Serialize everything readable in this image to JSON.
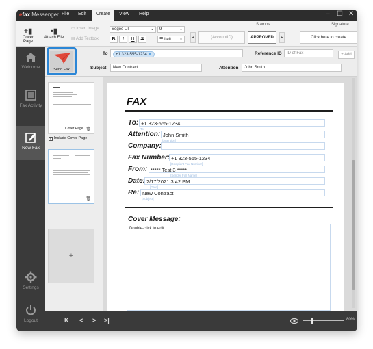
{
  "app": {
    "brand_e": "e",
    "brand": "fax",
    "product": "Messenger"
  },
  "menu": {
    "items": [
      "File",
      "Edit",
      "Create",
      "View",
      "Help"
    ],
    "active": "Create"
  },
  "window_controls": {
    "minimize": "–",
    "maximize": "☐",
    "close": "✕"
  },
  "ribbon": {
    "cover_page": "Cover Page",
    "attach_file": "Attach File",
    "insert_image": "Insert Image",
    "add_textbox": "Add Textbox",
    "font": "Segoe UI",
    "size": "9",
    "align": "Left",
    "bold": "B",
    "italic": "I",
    "underline": "U",
    "strike": "S",
    "stamps_label": "Stamps",
    "stamp_account": "(AccountID)",
    "stamp_approved": "APPROVED",
    "signature_label": "Signature",
    "signature_button": "Click here to create"
  },
  "sidebar": {
    "items": [
      {
        "label": "Welcome"
      },
      {
        "label": "Fax Activity"
      },
      {
        "label": "New Fax"
      },
      {
        "label": "Settings"
      },
      {
        "label": "Logout"
      }
    ],
    "active": "New Fax"
  },
  "header": {
    "send_fax": "Send Fax",
    "to_label": "To",
    "to_chip": "+1 323-555-1234",
    "reference_label": "Reference ID",
    "reference_placeholder": "ID of Fax",
    "add_label": "+ Add",
    "subject_label": "Subject",
    "subject_value": "New Contract",
    "attention_label": "Attention",
    "attention_value": "John Smith"
  },
  "thumbnails": {
    "cover_page": "Cover Page",
    "include_cover": "Include Cover Page",
    "include_checked": true,
    "add": "+"
  },
  "document": {
    "title": "FAX",
    "rows": [
      {
        "label": "To:",
        "value": "+1 323-555-1234",
        "hint": "To"
      },
      {
        "label": "Attention:",
        "value": "John Smith",
        "hint": "[Attention]"
      },
      {
        "label": "Company:",
        "value": "",
        "hint": ""
      },
      {
        "label": "Fax Number:",
        "value": "+1 323-555-1234",
        "hint": "[Recipient Fax Number]"
      },
      {
        "label": "From:",
        "value": "***** Test 3 *****",
        "hint": "[Sender Full Name]"
      },
      {
        "label": "Date:",
        "value": "2/17/2021 3:42 PM",
        "hint": "[Date]"
      },
      {
        "label": "Re:",
        "value": "New Contract",
        "hint": "[Subject]"
      }
    ],
    "cover_message_label": "Cover Message:",
    "cover_message_placeholder": "Double-click to edit"
  },
  "footer": {
    "first": "K",
    "prev": "<",
    "next": ">",
    "last": ">|",
    "zoom": "80%"
  },
  "colors": {
    "accent": "#2b86d6",
    "brand_red": "#e0483a",
    "sidebar": "#3a3a3a"
  }
}
